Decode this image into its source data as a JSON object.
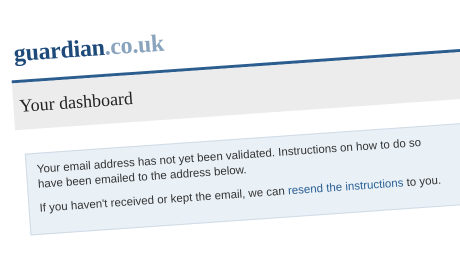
{
  "site": {
    "logo_brand": "guardian",
    "logo_domain": ".co.uk"
  },
  "page": {
    "title": "Your dashboard"
  },
  "notice": {
    "line1": "Your email address has not yet been validated. Instructions on how to do so",
    "line2": "have been emailed to the address below.",
    "line3_prefix": "If you haven't received or kept the email, we can ",
    "link_label": "resend the instructions",
    "line3_suffix": " to you."
  },
  "colors": {
    "brand": "#1e4a7a",
    "brand_light": "#8aa4be",
    "rule": "#2c5d8f",
    "title_band": "#ececec",
    "notice_bg": "#e9f0f6",
    "link": "#2a5f94"
  }
}
